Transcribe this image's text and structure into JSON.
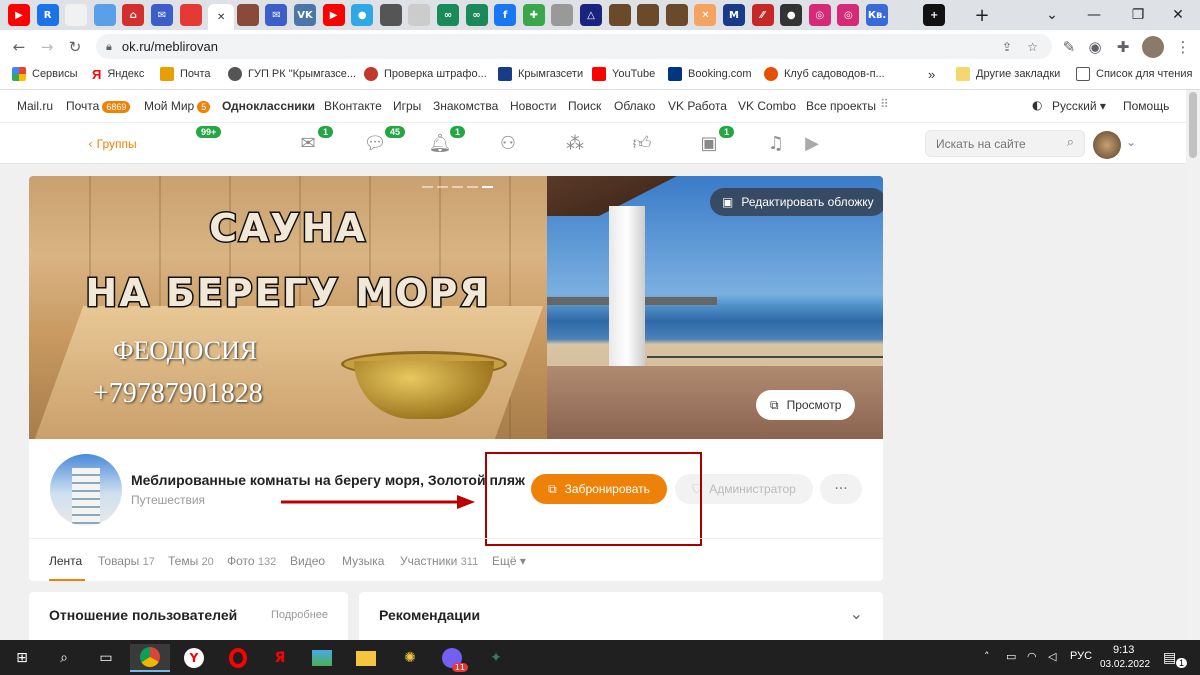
{
  "browser": {
    "tabs": [
      {
        "icon": "youtube-icon",
        "glyph": "▶",
        "color": "#ff0000"
      },
      {
        "icon": "rutube-icon",
        "glyph": "R",
        "color": "#1a73e8"
      },
      {
        "icon": "docs-icon",
        "glyph": "",
        "color": "#f1f1f1"
      },
      {
        "icon": "apps-icon",
        "glyph": "",
        "color": "#5aa0e8"
      },
      {
        "icon": "home-icon",
        "glyph": "⌂",
        "color": "#d32f2f"
      },
      {
        "icon": "mail-icon",
        "glyph": "✉",
        "color": "#3c5ec8"
      },
      {
        "icon": "red-icon",
        "glyph": "",
        "color": "#e53935"
      },
      {
        "icon": "close-icon",
        "glyph": "✕",
        "color": "#fff"
      },
      {
        "icon": "photo-icon",
        "glyph": "",
        "color": "#8a4a3a"
      },
      {
        "icon": "mail-icon",
        "glyph": "✉",
        "color": "#3c5ec8"
      },
      {
        "icon": "vk-icon",
        "glyph": "VK",
        "color": "#4a76a8"
      },
      {
        "icon": "youtube-icon",
        "glyph": "▶",
        "color": "#ff0000"
      },
      {
        "icon": "globe-icon",
        "glyph": "●",
        "color": "#2ea8e6"
      },
      {
        "icon": "photo-icon",
        "glyph": "",
        "color": "#555"
      },
      {
        "icon": "cloud-icon",
        "glyph": "",
        "color": "#ccc"
      },
      {
        "icon": "owl-icon",
        "glyph": "∞",
        "color": "#1a8a5a"
      },
      {
        "icon": "owl-icon",
        "glyph": "∞",
        "color": "#1a8a5a"
      },
      {
        "icon": "facebook-icon",
        "glyph": "f",
        "color": "#1877f2"
      },
      {
        "icon": "puzzle-icon",
        "glyph": "✚",
        "color": "#3aa84a"
      },
      {
        "icon": "photo-icon",
        "glyph": "",
        "color": "#999"
      },
      {
        "icon": "delta-icon",
        "glyph": "△",
        "color": "#1a237e"
      },
      {
        "icon": "photo-icon",
        "glyph": "",
        "color": "#6a4a2a"
      },
      {
        "icon": "photo-icon",
        "glyph": "",
        "color": "#6a4a2a"
      },
      {
        "icon": "photo-icon",
        "glyph": "",
        "color": "#6a4a2a"
      },
      {
        "icon": "tools-icon",
        "glyph": "✕",
        "color": "#f4a460"
      },
      {
        "icon": "m-icon",
        "glyph": "M",
        "color": "#1a3a8a"
      },
      {
        "icon": "slash-icon",
        "glyph": "⁄⁄",
        "color": "#c62828"
      },
      {
        "icon": "github-icon",
        "glyph": "●",
        "color": "#333"
      },
      {
        "icon": "instagram-icon",
        "glyph": "◎",
        "color": "#d62976"
      },
      {
        "icon": "instagram-icon",
        "glyph": "◎",
        "color": "#d62976"
      },
      {
        "icon": "kv-icon",
        "glyph": "Кв.",
        "color": "#3a6ad8"
      },
      {
        "icon": "blank-icon",
        "glyph": "",
        "color": "#dee1e6"
      },
      {
        "icon": "add-circle-icon",
        "glyph": "+",
        "color": "#111"
      }
    ],
    "new_tab": "+",
    "window_controls": {
      "collapse": "⌄",
      "minimize": "—",
      "restore": "❐",
      "close": "✕"
    },
    "url": "ok.ru/meblirovan",
    "bookmarks": [
      {
        "label": "Сервисы",
        "color": "#e94235"
      },
      {
        "label": "Яндекс",
        "color": "#ff0000"
      },
      {
        "label": "Почта",
        "color": "#e8a000"
      },
      {
        "label": "ГУП РК \"Крымгазсе...",
        "color": "#555"
      },
      {
        "label": "Проверка штрафо...",
        "color": "#c0392b"
      },
      {
        "label": "Крымгазсети",
        "color": "#1a3a8a"
      },
      {
        "label": "YouTube",
        "color": "#ff0000"
      },
      {
        "label": "Booking.com",
        "color": "#003580"
      },
      {
        "label": "Клуб садоводов-п...",
        "color": "#e65100"
      }
    ],
    "bookmarks_more": "»",
    "other_bookmarks": "Другие закладки",
    "reading_list": "Список для чтения"
  },
  "mailnav": {
    "items": [
      "Mail.ru",
      "Почта",
      "Мой Мир",
      "Одноклассники",
      "ВКонтакте",
      "Игры",
      "Знакомства",
      "Новости",
      "Поиск",
      "Облако",
      "VK Работа",
      "VK Combo",
      "Все проекты"
    ],
    "mail_count": "6869",
    "mir_count": "5",
    "language": "Русский ▾",
    "help": "Помощь"
  },
  "oknav": {
    "back": "Группы",
    "groups_badge": "99+",
    "badges": {
      "messages": "1",
      "discussions": "45",
      "notifications": "1",
      "video": "1"
    },
    "search_placeholder": "Искать на сайте"
  },
  "cover": {
    "title1": "САУНА",
    "title2": "НА БЕРЕГУ МОРЯ",
    "city": "ФЕОДОСИЯ",
    "phone": "+79787901828",
    "edit_cover": "Редактировать обложку",
    "preview": "Просмотр"
  },
  "group": {
    "name": "Меблированные комнаты на берегу моря, Золотой пляж",
    "category": "Путешествия",
    "book_button": "Забронировать",
    "admin_button": "Администратор",
    "more_button": "···"
  },
  "tabs": [
    {
      "label": "Лента",
      "count": ""
    },
    {
      "label": "Товары",
      "count": "17"
    },
    {
      "label": "Темы",
      "count": "20"
    },
    {
      "label": "Фото",
      "count": "132"
    },
    {
      "label": "Видео",
      "count": ""
    },
    {
      "label": "Музыка",
      "count": ""
    },
    {
      "label": "Участники",
      "count": "311"
    },
    {
      "label": "Ещё ▾",
      "count": ""
    }
  ],
  "panels": {
    "left_title": "Отношение пользователей",
    "left_link": "Подробнее",
    "right_title": "Рекомендации"
  },
  "taskbar": {
    "lang": "РУС",
    "time": "9:13",
    "date": "03.02.2022",
    "viber_badge": "11",
    "notif_count": "1"
  }
}
